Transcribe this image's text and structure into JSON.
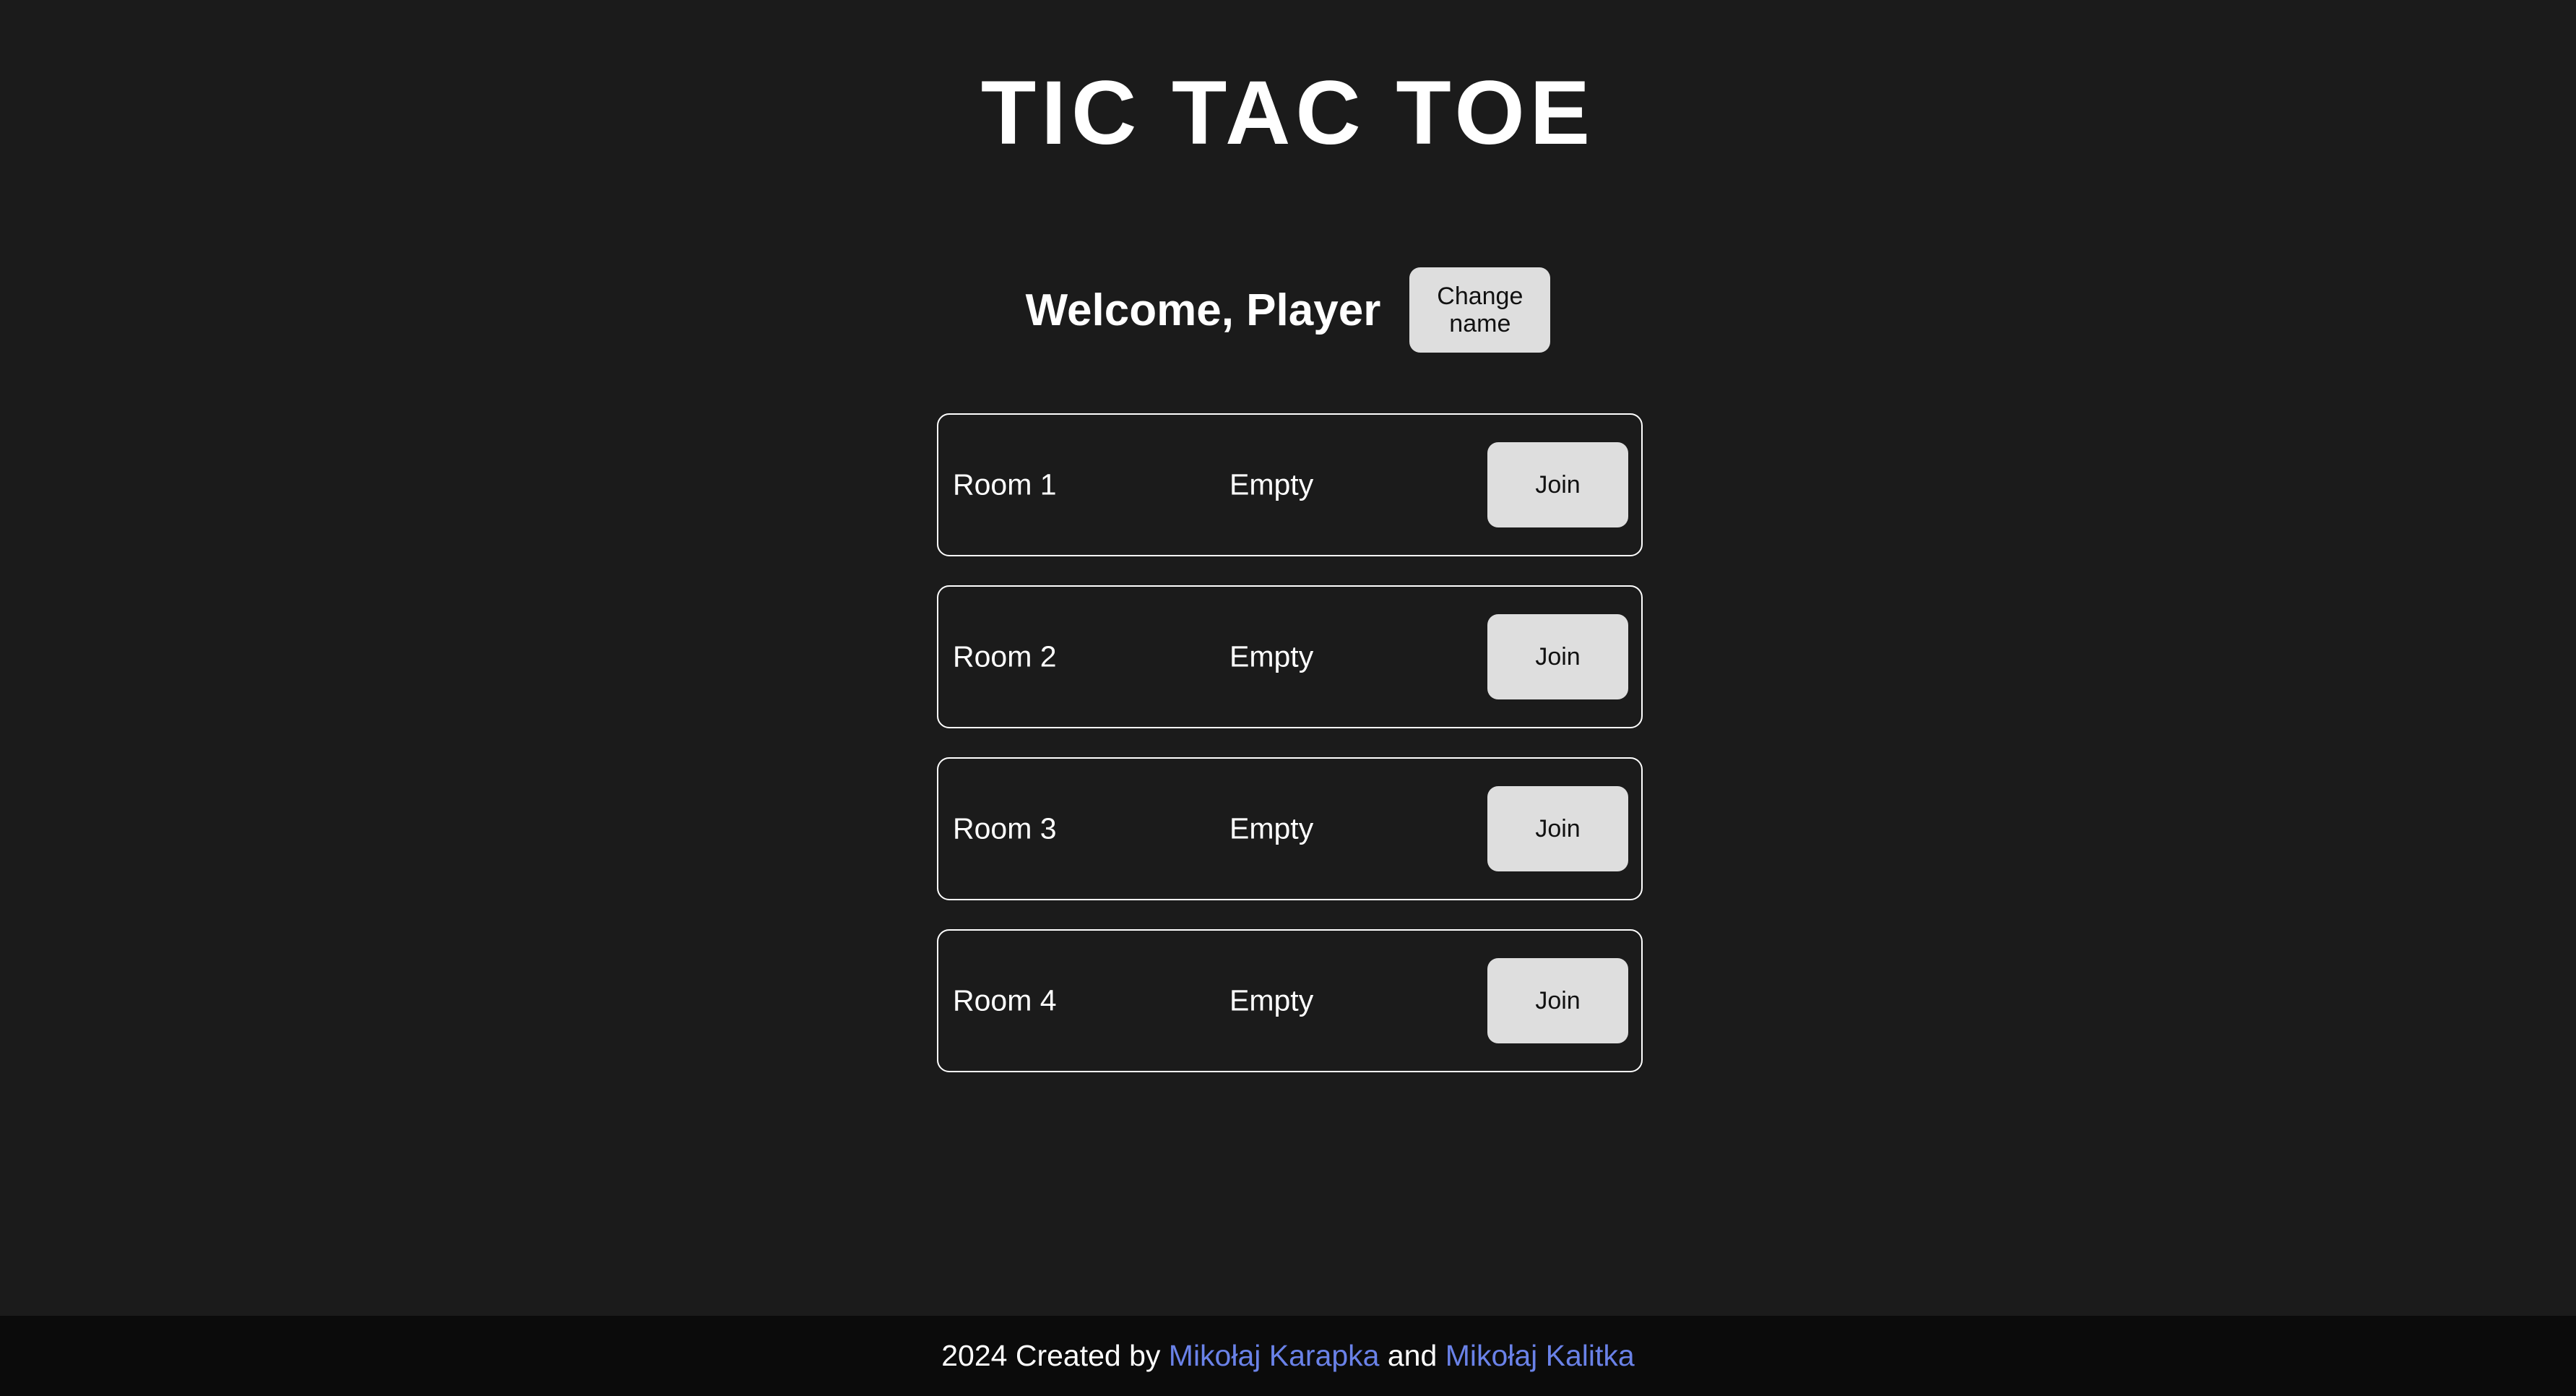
{
  "header": {
    "title": "TIC TAC TOE"
  },
  "welcome": {
    "text": "Welcome, Player",
    "change_name_label": "Change name"
  },
  "rooms": [
    {
      "name": "Room 1",
      "status": "Empty",
      "join_label": "Join"
    },
    {
      "name": "Room 2",
      "status": "Empty",
      "join_label": "Join"
    },
    {
      "name": "Room 3",
      "status": "Empty",
      "join_label": "Join"
    },
    {
      "name": "Room 4",
      "status": "Empty",
      "join_label": "Join"
    }
  ],
  "footer": {
    "prefix": "2024 Created by ",
    "author1": "Mikołaj Karapka",
    "separator": " and ",
    "author2": "Mikołaj Kalitka"
  },
  "colors": {
    "background": "#1b1b1b",
    "footer_background": "#0b0b0b",
    "button_background": "#dedede",
    "link": "#6a82e8"
  }
}
